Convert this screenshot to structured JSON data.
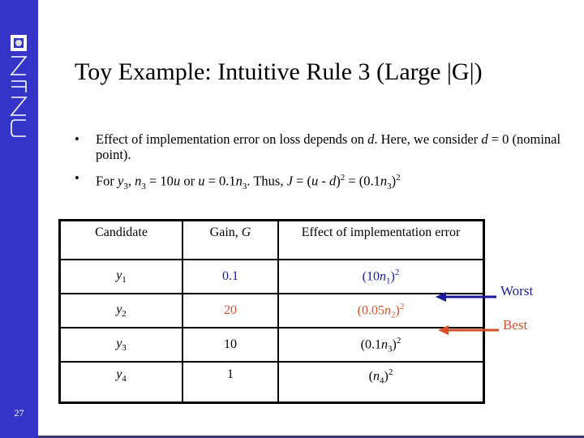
{
  "slide": {
    "number": "27",
    "logo_text": "NTNU",
    "title": "Toy Example: Intuitive Rule 3 (Large |G|)"
  },
  "colors": {
    "sidebar": "#3434c8",
    "worst": "#1a1a9a",
    "best": "#d8502a"
  },
  "bullets": [
    {
      "symbol": "•",
      "segments": [
        {
          "t": "Effect of implementation error on loss depends on "
        },
        {
          "t": "d",
          "s": "i"
        },
        {
          "t": ". Here, we consider "
        },
        {
          "t": "d",
          "s": "i"
        },
        {
          "t": " = 0 (nominal point)."
        }
      ]
    },
    {
      "symbol": "•",
      "segments": [
        {
          "t": "For "
        },
        {
          "t": "y",
          "s": "i"
        },
        {
          "t": "3",
          "s": "sub"
        },
        {
          "t": ",  "
        },
        {
          "t": "n",
          "s": "i"
        },
        {
          "t": "3",
          "s": "sub"
        },
        {
          "t": " = 10"
        },
        {
          "t": "u",
          "s": "i"
        },
        {
          "t": " or "
        },
        {
          "t": "u",
          "s": "i"
        },
        {
          "t": " = 0.1"
        },
        {
          "t": "n",
          "s": "i"
        },
        {
          "t": "3",
          "s": "sub"
        },
        {
          "t": ". Thus, "
        },
        {
          "t": "J",
          "s": "i"
        },
        {
          "t": " = ("
        },
        {
          "t": "u",
          "s": "i"
        },
        {
          "t": " - "
        },
        {
          "t": "d",
          "s": "i"
        },
        {
          "t": ")"
        },
        {
          "t": "2",
          "s": "sup"
        },
        {
          "t": " = (0.1"
        },
        {
          "t": "n",
          "s": "i"
        },
        {
          "t": "3",
          "s": "sub"
        },
        {
          "t": ")"
        },
        {
          "t": "2",
          "s": "sup"
        }
      ]
    }
  ],
  "table": {
    "headers": [
      [
        {
          "t": "Candidate"
        }
      ],
      [
        {
          "t": "Gain, "
        },
        {
          "t": "G",
          "s": "i"
        }
      ],
      [
        {
          "t": "Effect of implementation error"
        }
      ]
    ],
    "rows": [
      {
        "color": "",
        "gain_color": "blue",
        "cells": [
          [
            {
              "t": "y",
              "s": "i"
            },
            {
              "t": "1",
              "s": "sub"
            }
          ],
          [
            {
              "t": "0.1"
            }
          ],
          [
            {
              "t": "(10"
            },
            {
              "t": "n",
              "s": "i"
            },
            {
              "t": "1",
              "s": "sub"
            },
            {
              "t": ")"
            },
            {
              "t": "2",
              "s": "sup"
            }
          ]
        ]
      },
      {
        "color": "",
        "gain_color": "red",
        "cells": [
          [
            {
              "t": "y",
              "s": "i"
            },
            {
              "t": "2",
              "s": "sub"
            }
          ],
          [
            {
              "t": "20"
            }
          ],
          [
            {
              "t": "(0.05"
            },
            {
              "t": "n",
              "s": "i"
            },
            {
              "t": "2",
              "s": "sub"
            },
            {
              "t": ")"
            },
            {
              "t": "2",
              "s": "sup"
            }
          ]
        ]
      },
      {
        "color": "",
        "gain_color": "",
        "cells": [
          [
            {
              "t": "y",
              "s": "i"
            },
            {
              "t": "3",
              "s": "sub"
            }
          ],
          [
            {
              "t": "10"
            }
          ],
          [
            {
              "t": "(0.1"
            },
            {
              "t": "n",
              "s": "i"
            },
            {
              "t": "3",
              "s": "sub"
            },
            {
              "t": ")"
            },
            {
              "t": "2",
              "s": "sup"
            }
          ]
        ]
      },
      {
        "color": "",
        "gain_color": "",
        "cells": [
          [
            {
              "t": "y",
              "s": "i"
            },
            {
              "t": "4",
              "s": "sub"
            }
          ],
          [
            {
              "t": "1"
            }
          ],
          [
            {
              "t": "("
            },
            {
              "t": "n",
              "s": "i"
            },
            {
              "t": "4",
              "s": "sub"
            },
            {
              "t": ")"
            },
            {
              "t": "2",
              "s": "sup"
            }
          ]
        ]
      }
    ]
  },
  "annotations": {
    "worst": "Worst",
    "best": "Best"
  }
}
